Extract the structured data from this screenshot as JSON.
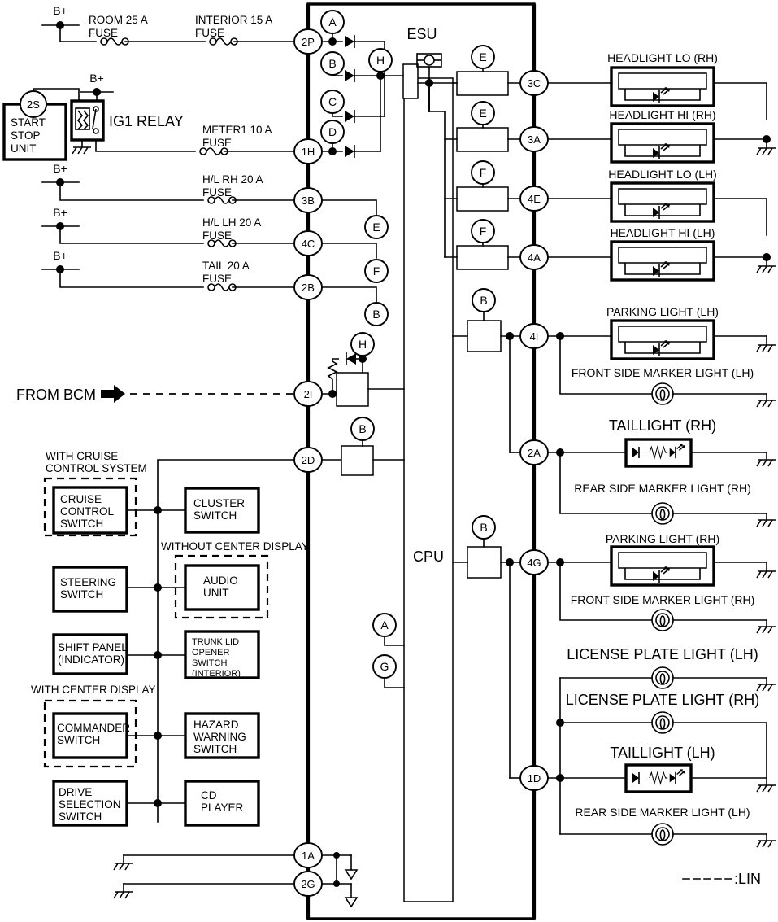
{
  "diagram": {
    "title": "ESU",
    "cpu_label": "CPU",
    "legend": "--------:LIN",
    "legend_text": ":LIN",
    "bcm_label": "FROM BCM",
    "relay_label": "IG1 RELAY",
    "bplus": "B+"
  },
  "left_sources": [
    {
      "id": "room-fuse",
      "label1": "ROOM 25 A",
      "label2": "FUSE"
    },
    {
      "id": "interior-fuse",
      "label1": "INTERIOR 15 A",
      "label2": "FUSE"
    },
    {
      "id": "meter1-fuse",
      "label1": "METER1 10 A",
      "label2": "FUSE"
    },
    {
      "id": "hl-rh-fuse",
      "label1": "H/L RH 20 A",
      "label2": "FUSE"
    },
    {
      "id": "hl-lh-fuse",
      "label1": "H/L LH 20 A",
      "label2": "FUSE"
    },
    {
      "id": "tail-fuse",
      "label1": "TAIL 20 A",
      "label2": "FUSE"
    }
  ],
  "start_stop_unit": {
    "line1": "START",
    "line2": "STOP",
    "line3": "UNIT",
    "pin": "2S"
  },
  "left_connector_pins": [
    "2P",
    "1H",
    "3B",
    "4C",
    "2B",
    "2I",
    "2D",
    "1A",
    "2G"
  ],
  "right_connector_pins": [
    "3C",
    "3A",
    "4E",
    "4A",
    "4I",
    "2A",
    "4G",
    "1D"
  ],
  "input_letters": [
    "A",
    "B",
    "C",
    "D"
  ],
  "bus_letters": [
    "E",
    "F",
    "B"
  ],
  "driver_letters": [
    "E",
    "E",
    "F",
    "F",
    "B",
    "B"
  ],
  "internal_letters": [
    "H",
    "H",
    "B",
    "A",
    "G"
  ],
  "loads": [
    {
      "id": "headlight-lo-rh",
      "label": "HEADLIGHT LO (RH)",
      "type": "led-block"
    },
    {
      "id": "headlight-hi-rh",
      "label": "HEADLIGHT HI (RH)",
      "type": "led-block"
    },
    {
      "id": "headlight-lo-lh",
      "label": "HEADLIGHT LO (LH)",
      "type": "led-block"
    },
    {
      "id": "headlight-hi-lh",
      "label": "HEADLIGHT HI (LH)",
      "type": "led-block"
    },
    {
      "id": "parking-light-lh",
      "label": "PARKING LIGHT (LH)",
      "type": "led-block"
    },
    {
      "id": "front-side-marker-lh",
      "label": "FRONT SIDE MARKER LIGHT (LH)",
      "type": "bulb"
    },
    {
      "id": "taillight-rh",
      "label": "TAILLIGHT (RH)",
      "type": "led-resistor"
    },
    {
      "id": "rear-side-marker-rh",
      "label": "REAR SIDE MARKER LIGHT (RH)",
      "type": "bulb"
    },
    {
      "id": "parking-light-rh",
      "label": "PARKING LIGHT (RH)",
      "type": "led-block"
    },
    {
      "id": "front-side-marker-rh",
      "label": "FRONT SIDE MARKER LIGHT (RH)",
      "type": "bulb"
    },
    {
      "id": "license-plate-light-lh",
      "label": "LICENSE PLATE LIGHT (LH)",
      "type": "bulb"
    },
    {
      "id": "license-plate-light-rh",
      "label": "LICENSE PLATE LIGHT (RH)",
      "type": "bulb"
    },
    {
      "id": "taillight-lh",
      "label": "TAILLIGHT (LH)",
      "type": "led-resistor"
    },
    {
      "id": "rear-side-marker-lh",
      "label": "REAR SIDE MARKER LIGHT (LH)",
      "type": "bulb"
    }
  ],
  "option_groups": [
    {
      "id": "with-cruise-control",
      "line1": "WITH CRUISE",
      "line2": "CONTROL SYSTEM"
    },
    {
      "id": "without-center-display",
      "line1": "WITHOUT CENTER DISPLAY",
      "line2": ""
    },
    {
      "id": "with-center-display",
      "line1": "WITH CENTER DISPLAY",
      "line2": ""
    }
  ],
  "modules": [
    {
      "id": "cruise-control-switch",
      "lines": [
        "CRUISE",
        "CONTROL",
        "SWITCH"
      ],
      "small": false
    },
    {
      "id": "cluster-switch",
      "lines": [
        "CLUSTER",
        "SWITCH"
      ],
      "small": false
    },
    {
      "id": "steering-switch",
      "lines": [
        "STEERING",
        "SWITCH"
      ],
      "small": false
    },
    {
      "id": "audio-unit",
      "lines": [
        "AUDIO",
        "UNIT"
      ],
      "small": false
    },
    {
      "id": "shift-panel",
      "lines": [
        "SHIFT PANEL",
        "(INDICATOR)"
      ],
      "small": false
    },
    {
      "id": "trunk-lid-opener-switch",
      "lines": [
        "TRUNK LID",
        "OPENER",
        "SWITCH",
        "(INTERIOR)"
      ],
      "small": true
    },
    {
      "id": "commander-switch",
      "lines": [
        "COMMANDER",
        "SWITCH"
      ],
      "small": false
    },
    {
      "id": "hazard-warning-switch",
      "lines": [
        "HAZARD",
        "WARNING",
        "SWITCH"
      ],
      "small": false
    },
    {
      "id": "drive-selection-switch",
      "lines": [
        "DRIVE",
        "SELECTION",
        "SWITCH"
      ],
      "small": false
    },
    {
      "id": "cd-player",
      "lines": [
        "CD",
        "PLAYER"
      ],
      "small": false
    }
  ]
}
